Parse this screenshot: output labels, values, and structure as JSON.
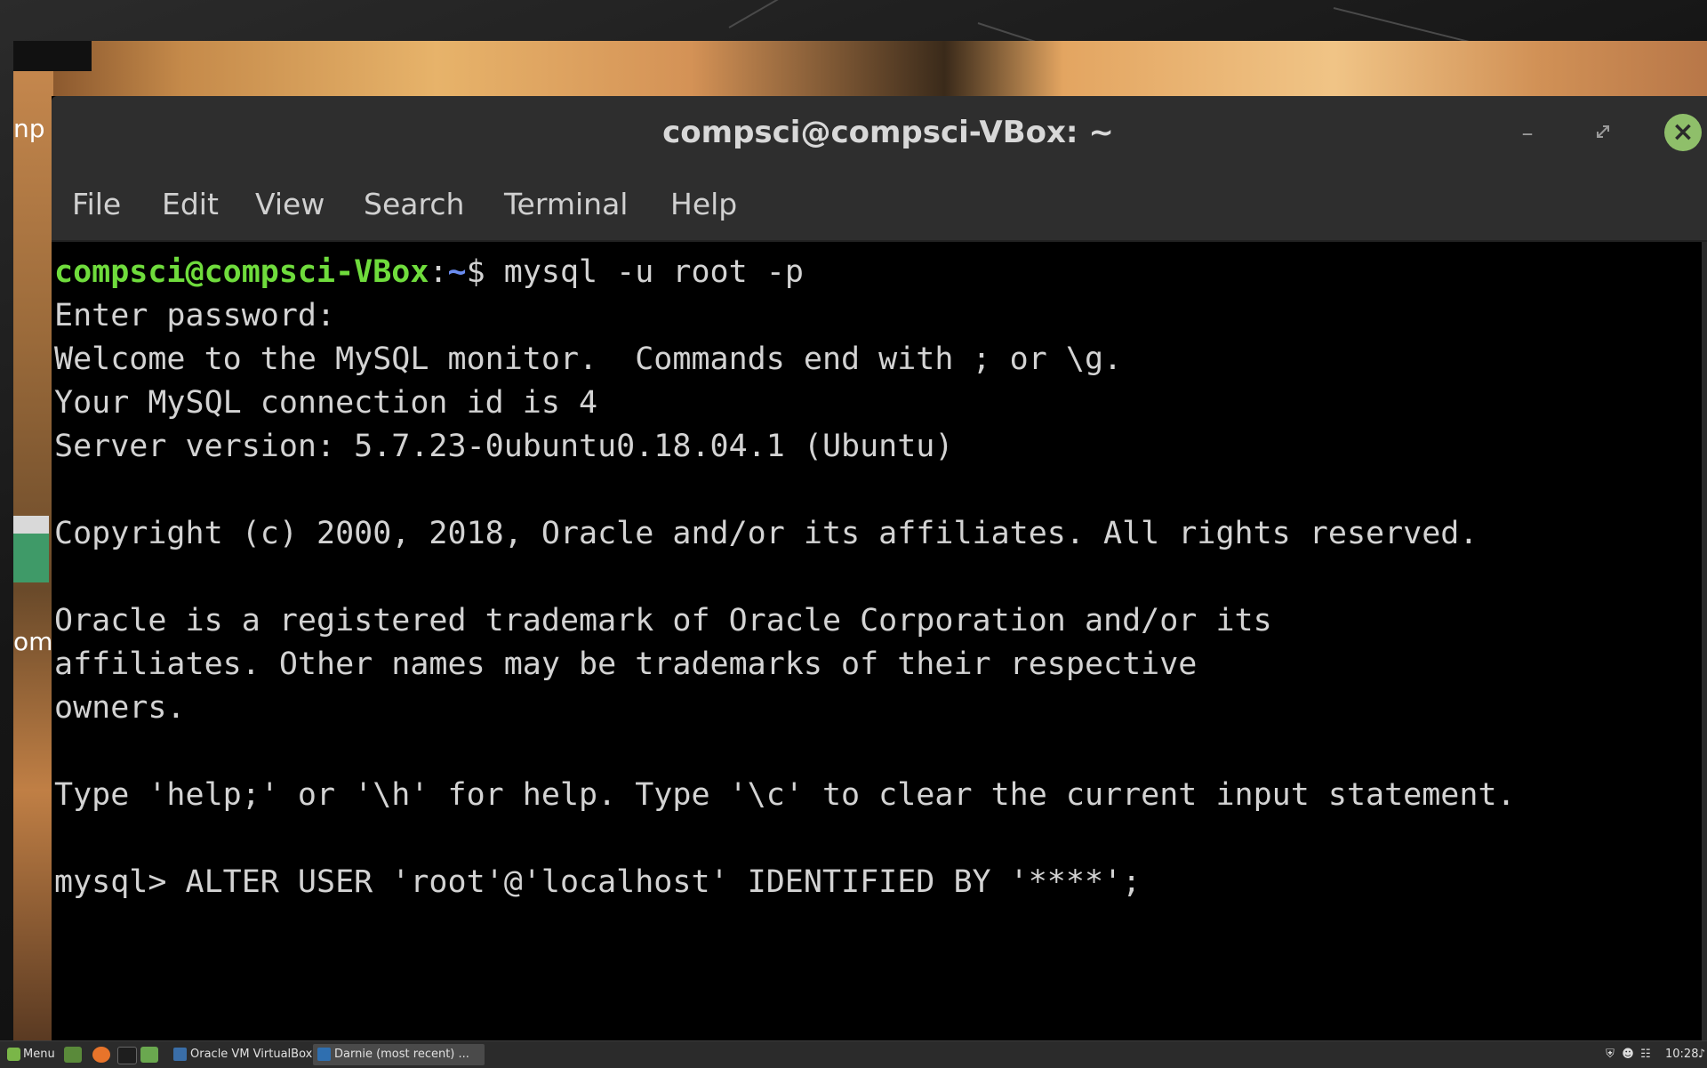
{
  "window": {
    "title": "compsci@compsci-VBox: ~",
    "minimize_icon": "minimize-icon",
    "maximize_icon": "maximize-icon",
    "close_icon": "close-icon"
  },
  "menubar": {
    "items": [
      "File",
      "Edit",
      "View",
      "Search",
      "Terminal",
      "Help"
    ]
  },
  "terminal": {
    "prompt_user": "compsci@compsci-VBox",
    "prompt_sep": ":",
    "prompt_path": "~",
    "prompt_dollar": "$ ",
    "command": "mysql -u root -p",
    "lines": [
      "Enter password:",
      "Welcome to the MySQL monitor.  Commands end with ; or \\g.",
      "Your MySQL connection id is 4",
      "Server version: 5.7.23-0ubuntu0.18.04.1 (Ubuntu)",
      "",
      "Copyright (c) 2000, 2018, Oracle and/or its affiliates. All rights reserved.",
      "",
      "Oracle is a registered trademark of Oracle Corporation and/or its",
      "affiliates. Other names may be trademarks of their respective",
      "owners.",
      "",
      "Type 'help;' or '\\h' for help. Type '\\c' to clear the current input statement.",
      "",
      "mysql> ALTER USER 'root'@'localhost' IDENTIFIED BY '****';"
    ]
  },
  "desktop": {
    "fragment_top": "np",
    "fragment_bottom": "om"
  },
  "taskbar": {
    "menu_label": "Menu",
    "tasks": [
      {
        "label": "Oracle VM VirtualBox...",
        "icon": "virtualbox-icon"
      },
      {
        "label": "Darnie (most recent) ...",
        "icon": "document-icon"
      }
    ],
    "clock": "10:28",
    "colors": {
      "accent": "#7ab648",
      "user_prompt": "#6fdc3c",
      "path_prompt": "#6a8cf0"
    }
  }
}
